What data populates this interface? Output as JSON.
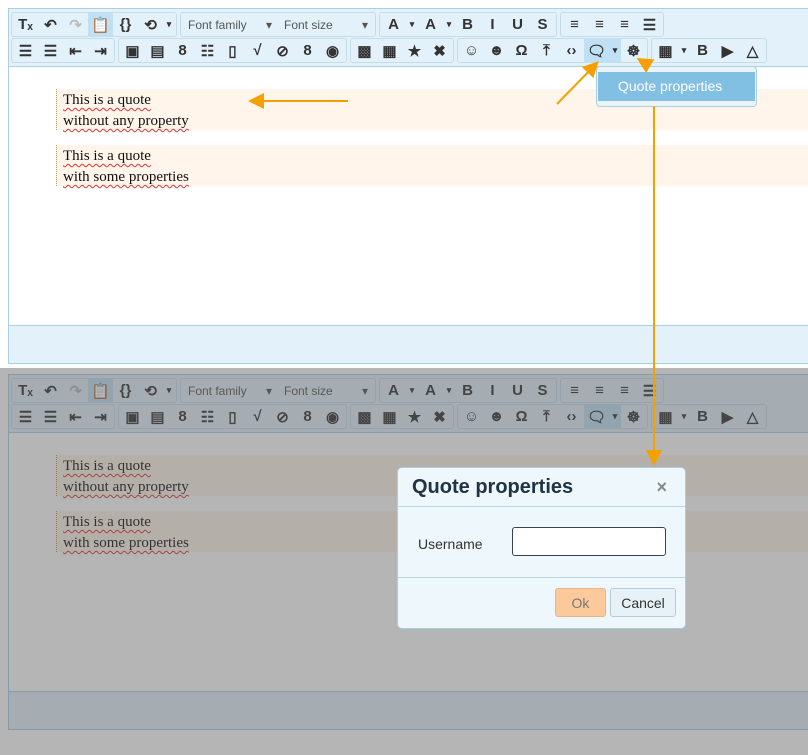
{
  "toolbar": {
    "font_family": "Font family",
    "font_size": "Font size",
    "row1": [
      [
        {
          "icon": "clear-format-icon",
          "g": "Tₓ"
        },
        {
          "icon": "undo-icon",
          "g": "↶"
        },
        {
          "icon": "redo-icon",
          "g": "↷",
          "dim": true
        },
        {
          "icon": "paste-icon",
          "g": "📋",
          "active": true
        },
        {
          "icon": "source-code-icon",
          "g": "{}"
        },
        {
          "icon": "history-icon",
          "g": "⟲"
        },
        {
          "icon": "chevron-down-icon",
          "g": "▾",
          "caret": true
        }
      ],
      "selects",
      [
        {
          "icon": "font-color-icon",
          "g": "A"
        },
        {
          "icon": "chevron-down-icon",
          "g": "▾",
          "caret": true
        },
        {
          "icon": "background-color-icon",
          "g": "A"
        },
        {
          "icon": "chevron-down-icon",
          "g": "▾",
          "caret": true
        },
        {
          "icon": "bold-icon",
          "g": "B"
        },
        {
          "icon": "italic-icon",
          "g": "I"
        },
        {
          "icon": "underline-icon",
          "g": "U"
        },
        {
          "icon": "strikethrough-icon",
          "g": "S"
        }
      ],
      [
        {
          "icon": "align-left-icon",
          "g": "≡"
        },
        {
          "icon": "align-center-icon",
          "g": "≡"
        },
        {
          "icon": "align-right-icon",
          "g": "≡"
        },
        {
          "icon": "align-justify-icon",
          "g": "☰"
        }
      ]
    ],
    "row2": [
      [
        {
          "icon": "bullet-list-icon",
          "g": "☰"
        },
        {
          "icon": "numbered-list-icon",
          "g": "☰"
        },
        {
          "icon": "outdent-icon",
          "g": "⇤"
        },
        {
          "icon": "indent-icon",
          "g": "⇥"
        }
      ],
      [
        {
          "icon": "image-gallery-icon",
          "g": "▣"
        },
        {
          "icon": "document-image-icon",
          "g": "▤"
        },
        {
          "icon": "google-icon",
          "g": "8"
        },
        {
          "icon": "news-icon",
          "g": "☷"
        },
        {
          "icon": "page-icon",
          "g": "▯"
        },
        {
          "icon": "sqrt-icon",
          "g": "√"
        },
        {
          "icon": "hide-icon",
          "g": "⊘"
        },
        {
          "icon": "google-alt-icon",
          "g": "8"
        },
        {
          "icon": "shutter-icon",
          "g": "◉"
        }
      ],
      [
        {
          "icon": "image-icon",
          "g": "▩"
        },
        {
          "icon": "media-icon",
          "g": "▦"
        },
        {
          "icon": "link-icon",
          "g": "★"
        },
        {
          "icon": "unlink-icon",
          "g": "✖"
        }
      ],
      [
        {
          "icon": "emoticon-icon",
          "g": "☺"
        },
        {
          "icon": "emoticon-cool-icon",
          "g": "☻"
        },
        {
          "icon": "special-char-icon",
          "g": "Ω"
        },
        {
          "icon": "upload-icon",
          "g": "⤒"
        },
        {
          "icon": "code-file-icon",
          "g": "‹›"
        },
        {
          "icon": "quote-icon",
          "g": "🗨",
          "active": true
        },
        {
          "icon": "chevron-down-icon",
          "g": "▾",
          "caret": true,
          "active": true
        },
        {
          "icon": "mask-icon",
          "g": "☸"
        }
      ],
      [
        {
          "icon": "table-icon",
          "g": "▦"
        },
        {
          "icon": "chevron-down-icon",
          "g": "▾",
          "caret": true
        },
        {
          "icon": "bold-alt-icon",
          "g": "B"
        },
        {
          "icon": "video-icon",
          "g": "▶"
        },
        {
          "icon": "drive-icon",
          "g": "△"
        }
      ]
    ]
  },
  "quotes": [
    {
      "line1": "This is a quote",
      "line2": "without any property"
    },
    {
      "line1": "This is a quote",
      "line2": "with some properties"
    }
  ],
  "menu": {
    "item": "Quote properties"
  },
  "dialog": {
    "title": "Quote properties",
    "close": "×",
    "username_label": "Username",
    "username_value": "",
    "ok": "Ok",
    "cancel": "Cancel"
  },
  "colors": {
    "arrow": "#f5a000",
    "quote_bg": "#fff5ea",
    "toolbar_bg": "#e3f1fa"
  }
}
